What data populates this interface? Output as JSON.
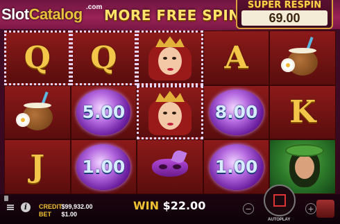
{
  "header": {
    "logo_text_a": "Slot",
    "logo_text_b": "Catalog",
    "logo_sup": ".com",
    "banner_text": "MORE FREE SPINS",
    "super_respin_label": "SUPER RESPIN",
    "super_respin_value": "69.00"
  },
  "reels": [
    [
      {
        "type": "letter",
        "value": "Q",
        "lit": true
      },
      {
        "type": "coconut",
        "lit": false
      },
      {
        "type": "letter",
        "value": "J",
        "lit": false
      }
    ],
    [
      {
        "type": "letter",
        "value": "Q",
        "lit": true
      },
      {
        "type": "orb",
        "value": "5.00",
        "lit": false
      },
      {
        "type": "orb",
        "value": "1.00",
        "lit": false
      }
    ],
    [
      {
        "type": "queen",
        "lit": true
      },
      {
        "type": "queen",
        "lit": true
      },
      {
        "type": "mask",
        "lit": false
      }
    ],
    [
      {
        "type": "letter",
        "value": "A",
        "lit": false
      },
      {
        "type": "orb",
        "value": "8.00",
        "lit": false
      },
      {
        "type": "orb",
        "value": "1.00",
        "lit": false
      }
    ],
    [
      {
        "type": "coconut",
        "lit": false
      },
      {
        "type": "letter",
        "value": "K",
        "lit": false
      },
      {
        "type": "lady",
        "lit": false
      }
    ]
  ],
  "footer": {
    "credit_label": "CREDIT",
    "credit_value": "$99,932.00",
    "bet_label": "BET",
    "bet_value": "$1.00",
    "win_label": "WIN",
    "win_value": "$22.00",
    "minus_label": "−",
    "plus_label": "+",
    "autoplay_label": "AUTOPLAY",
    "info_label": "i"
  },
  "colors": {
    "accent_gold": "#f1c232",
    "reel_bg": "#8c1a1a",
    "orb_purple": "#b66ae0"
  },
  "icons": {
    "menu": "menu-icon",
    "info": "info-icon",
    "speaker": "speaker-icon",
    "spin": "spin-stop-icon",
    "chest": "treasure-chest-icon"
  }
}
